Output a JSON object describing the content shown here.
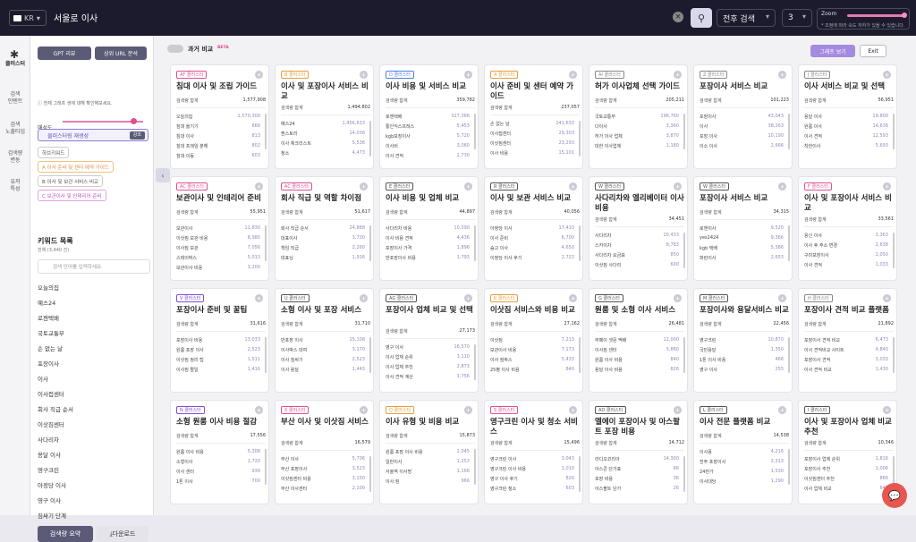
{
  "topbar": {
    "country": "KR",
    "query": "서울로 이사",
    "clear": "×",
    "mode": "전후 검색",
    "depth": "3",
    "zoom_label": "Zoom",
    "zoom_hint": "* 조정에 따라 속도 저하가 있을 수 있습니다."
  },
  "rail": [
    {
      "label": "클러스터"
    },
    {
      "label": "검색\n인텐트"
    },
    {
      "label": "검색\n노출타입"
    },
    {
      "label": "검색량\n변동"
    },
    {
      "label": "유저\n특성"
    }
  ],
  "panel": {
    "gpt": "GPT 리뷰",
    "url": "상위 URL 분석",
    "note": "전체 그래프 생에 대해 확인해보세요.",
    "slider_label": "매성도",
    "cluster_btn": "클러스터링 재생성",
    "cluster_toggle": "강조",
    "tags": [
      {
        "t": "하브키워드",
        "c": "#555",
        "b": "#ccc",
        "bg": "#fff"
      },
      {
        "t": "A 이사 준비 및 센터 예약 가이드",
        "c": "#e09040",
        "b": "#f0c080",
        "bg": "#fff"
      },
      {
        "t": "B 이사 및 보관 서비스 비교",
        "c": "#555",
        "b": "#ccc",
        "bg": "#fff"
      },
      {
        "t": "C 보관이사 및 인테리어 준비",
        "c": "#c050c0",
        "b": "#e0a0e0",
        "bg": "#fff"
      }
    ],
    "kw_title": "키워드 목록",
    "kw_sub": "전체 (3,440 건)",
    "kw_placeholder": "검색 단어를 입력하세요.",
    "keywords": [
      "오늘의집",
      "예스24",
      "로젠택배",
      "국토교통부",
      "손 없는 날",
      "포장이사",
      "이사",
      "이사접센터",
      "회사 직급 순서",
      "이삿짐센터",
      "사다리차",
      "용달 이사",
      "영구크린",
      "아정당 이사",
      "영구 이사",
      "짐싸기 단계"
    ],
    "summary": "검색량 요약",
    "download": "다운로드"
  },
  "main": {
    "compare": "과거 비교",
    "beta": "BETA",
    "graph": "그래프 보기",
    "exit": "Exit"
  },
  "cards": [
    {
      "badge": "AF 클러스터",
      "bc": "#e05090",
      "title": "침대 이사 및 조립 가이드",
      "vol": "1,577,908",
      "rows": [
        [
          "오늘의집",
          "1,570,300"
        ],
        [
          "침대 옮기기",
          "866"
        ],
        [
          "침대 이사",
          "813"
        ],
        [
          "침대 프레임 분해",
          "802"
        ],
        [
          "침대 이동",
          "603"
        ]
      ]
    },
    {
      "badge": "B 클러스터",
      "bc": "#e0a040",
      "title": "이사 및 포장이사 서비스 비교",
      "vol": "1,494,802",
      "rows": [
        [
          "예스24",
          "1,456,633"
        ],
        [
          "퀀스토리",
          "14,036"
        ],
        [
          "이사 체크리스트",
          "5,536"
        ],
        [
          "청소",
          "4,473"
        ]
      ]
    },
    {
      "badge": "D 클러스터",
      "bc": "#5080e0",
      "title": "이사 비용 및 서비스 비교",
      "vol": "359,782",
      "rows": [
        [
          "로젠택배",
          "327,366"
        ],
        [
          "통인익스프레스",
          "5,453"
        ],
        [
          "kgb포장이사",
          "5,720"
        ],
        [
          "이사비",
          "3,060"
        ],
        [
          "이사 견적",
          "2,730"
        ]
      ]
    },
    {
      "badge": "A 클러스터",
      "bc": "#e0a040",
      "title": "이사 준비 및 센터 예약 가이드",
      "vol": "237,057",
      "rows": [
        [
          "손 없는 날",
          "141,633"
        ],
        [
          "이사접센터",
          "29,303"
        ],
        [
          "이삿짐센터",
          "23,293"
        ],
        [
          "이사 비용",
          "15,101"
        ]
      ]
    },
    {
      "badge": "AI 클러스터",
      "bc": "#888",
      "title": "허가 이사업체 선택 가이드",
      "vol": "205,211",
      "rows": [
        [
          "국토교통부",
          "196,760"
        ],
        [
          "다이사",
          "3,360"
        ],
        [
          "허가 이사 업체",
          "3,870"
        ],
        [
          "대한 이사업체",
          "1,180"
        ]
      ]
    },
    {
      "badge": "Z 클러스터",
      "bc": "#888",
      "title": "포장이사 서비스 비교",
      "vol": "101,223",
      "rows": [
        [
          "포장이사",
          "43,043"
        ],
        [
          "이사",
          "38,263"
        ],
        [
          "포장 이사",
          "10,190"
        ],
        [
          "이소 이사",
          "2,666"
        ]
      ]
    },
    {
      "badge": "J 클러스터",
      "bc": "#888",
      "title": "이사 서비스 비교 및 선택",
      "vol": "56,951",
      "rows": [
        [
          "용달 이사",
          "19,800"
        ],
        [
          "원룸 이사",
          "14,636"
        ],
        [
          "이사 견적",
          "12,593"
        ],
        [
          "착한이사",
          "5,693"
        ]
      ]
    },
    {
      "badge": "AC 클러스터",
      "bc": "#e05090",
      "title": "보관이사 및 인테리어 준비",
      "vol": "55,951",
      "rows": [
        [
          "보관이사",
          "11,830"
        ],
        [
          "이삿짐 보관 비용",
          "8,980"
        ],
        [
          "이사짐 보관",
          "7,056"
        ],
        [
          "스테이박스",
          "5,013"
        ],
        [
          "보관이사 비용",
          "3,200"
        ]
      ]
    },
    {
      "badge": "AC 클러스터",
      "bc": "#e05090",
      "title": "회사 직급 및 역할 차이점",
      "vol": "51,617",
      "rows": [
        [
          "회사 직급 순서",
          "24,888"
        ],
        [
          "대표이사",
          "3,730"
        ],
        [
          "책임 직급",
          "2,260"
        ],
        [
          "대표님",
          "1,916"
        ]
      ]
    },
    {
      "badge": "E 클러스터",
      "bc": "#555",
      "title": "이사 비용 및 업체 비교",
      "vol": "44,897",
      "rows": [
        [
          "사다리차 비용",
          "10,590"
        ],
        [
          "이사 비용 견적",
          "4,436"
        ],
        [
          "포장이사 가격",
          "1,896"
        ],
        [
          "반포장이사 비용",
          "1,793"
        ]
      ]
    },
    {
      "badge": "R 클러스터",
      "bc": "#555",
      "title": "이사 및 보관 서비스 비교",
      "vol": "40,056",
      "rows": [
        [
          "아정당 이사",
          "17,410"
        ],
        [
          "이사 준비",
          "6,700"
        ],
        [
          "숨고 이사",
          "4,650"
        ],
        [
          "이정당 이사 후기",
          "2,723"
        ]
      ]
    },
    {
      "badge": "W 클러스터",
      "bc": "#555",
      "title": "사다리차와 엘리베이터 이사 비용",
      "vol": "34,451",
      "rows": [
        [
          "사다리차",
          "20,433"
        ],
        [
          "스카이차",
          "8,783"
        ],
        [
          "사다리차 요금표",
          "850"
        ],
        [
          "이삿짐 사다리",
          "600"
        ]
      ]
    },
    {
      "badge": "W 클러스터",
      "bc": "#555",
      "title": "포장이사 서비스 비교",
      "vol": "34,315",
      "rows": [
        [
          "로젠이사",
          "9,520"
        ],
        [
          "yes2424",
          "9,366"
        ],
        [
          "kgb 택배",
          "5,386"
        ],
        [
          "파란이사",
          "2,653"
        ]
      ]
    },
    {
      "badge": "F 클러스터",
      "bc": "#e05090",
      "title": "이사 및 포장이사 서비스 비교",
      "vol": "33,561",
      "rows": [
        [
          "용신 이사",
          "3,363"
        ],
        [
          "이사 후 주소 변경",
          "2,638"
        ],
        [
          "구미포장이사",
          "2,050"
        ],
        [
          "이사 견적",
          "1,033"
        ]
      ]
    },
    {
      "badge": "V 클러스터",
      "bc": "#8050d0",
      "title": "포장이사 준비 및 꿀팁",
      "vol": "31,616",
      "rows": [
        [
          "포장이사 비용",
          "13,033"
        ],
        [
          "원룸 포장 이사",
          "2,523"
        ],
        [
          "이삿짐 정리 팁",
          "1,511"
        ],
        [
          "이사짐 짤일",
          "1,416"
        ]
      ]
    },
    {
      "badge": "U 클러스터",
      "bc": "#555",
      "title": "소형 이사 및 포장 서비스",
      "vol": "31,710",
      "rows": [
        [
          "반포장 이사",
          "15,108"
        ],
        [
          "이사박스 대여",
          "3,170"
        ],
        [
          "이사 침싸기",
          "2,523"
        ],
        [
          "이사 용달",
          "1,443"
        ]
      ]
    },
    {
      "badge": "AG 클러스터",
      "bc": "#555",
      "title": "포장이사 업체 비교 및 선택",
      "vol": "27,173",
      "rows": [
        [
          "영구 이사",
          "16,570"
        ],
        [
          "이사 업체 순위",
          "3,110"
        ],
        [
          "이사 업체 추천",
          "2,873"
        ],
        [
          "이사 견적 계산",
          "1,756"
        ]
      ]
    },
    {
      "badge": "K 클러스터",
      "bc": "#e0a040",
      "title": "이삿짐 서비스와 비용 비교",
      "vol": "27,162",
      "rows": [
        [
          "이삿짐",
          "7,213"
        ],
        [
          "보관이사 비용",
          "7,173"
        ],
        [
          "이사 짐박스",
          "5,433"
        ],
        [
          "25평 이사 비용",
          "840"
        ]
      ]
    },
    {
      "badge": "G 클러스터",
      "bc": "#555",
      "title": "원룸 및 소형 이사 서비스",
      "vol": "26,481",
      "rows": [
        [
          "부페이 셋문 맥배",
          "12,000"
        ],
        [
          "이사짐 센터",
          "3,860"
        ],
        [
          "원룸 이사 비용",
          "840"
        ],
        [
          "용달 이사 비용",
          "826"
        ]
      ]
    },
    {
      "badge": "M 클러스터",
      "bc": "#555",
      "title": "포장이사와 용달서비스 비교",
      "vol": "22,456",
      "rows": [
        [
          "영구크린",
          "10,870"
        ],
        [
          "국민용달",
          "1,350"
        ],
        [
          "1톤 이사 비용",
          "466"
        ],
        [
          "영구 이사",
          "255"
        ]
      ]
    },
    {
      "badge": "H 클러스터",
      "bc": "#888",
      "title": "포장이사 견적 비교 플랫폼",
      "vol": "21,892",
      "rows": [
        [
          "포장이사 견적 비교",
          "6,473"
        ],
        [
          "이사 견적비교 사이트",
          "4,840"
        ],
        [
          "포장이사 견적",
          "3,033"
        ],
        [
          "이사 견적 비교",
          "1,430"
        ]
      ]
    },
    {
      "badge": "N 클러스터",
      "bc": "#8050d0",
      "title": "소형 원룸 이사 비용 절감",
      "vol": "17,556",
      "rows": [
        [
          "원룸 이사 비용",
          "5,308"
        ],
        [
          "소형이사",
          "1,720"
        ],
        [
          "이사 센터",
          "936"
        ],
        [
          "1톤 이사",
          "700"
        ]
      ]
    },
    {
      "badge": "X 클러스터",
      "bc": "#e05090",
      "title": "부산 이사 및 이삿짐 서비스",
      "vol": "16,579",
      "rows": [
        [
          "부산 이사",
          "5,706"
        ],
        [
          "부산 포장이사",
          "3,523"
        ],
        [
          "이삿짐센터 비용",
          "3,150"
        ],
        [
          "부산 이사센터",
          "2,100"
        ]
      ]
    },
    {
      "badge": "Q 클러스터",
      "bc": "#e0a040",
      "title": "이사 유형 및 비용 비교",
      "vol": "15,873",
      "rows": [
        [
          "원룸 포장 이사 비용",
          "2,045"
        ],
        [
          "일반이사",
          "1,253"
        ],
        [
          "서울역 이사방",
          "1,166"
        ],
        [
          "이사 짐",
          "966"
        ]
      ]
    },
    {
      "badge": "S 클러스터",
      "bc": "#e05090",
      "title": "영구크린 이사 및 청소 서비스",
      "vol": "15,496",
      "rows": [
        [
          "영구크린 이사",
          "3,043"
        ],
        [
          "영구크린 이사 비용",
          "1,010"
        ],
        [
          "영구 이사 후기",
          "826"
        ],
        [
          "영구크린 청소",
          "603"
        ]
      ]
    },
    {
      "badge": "AD 클러스터",
      "bc": "#555",
      "title": "엘에이 포장이사 및 아스팔트 포장 비용",
      "vol": "14,712",
      "rows": [
        [
          "라디오코리아",
          "14,300"
        ],
        [
          "아스콘 단가표",
          "66"
        ],
        [
          "포장 비용",
          "36"
        ],
        [
          "아스팔트 단가",
          "26"
        ]
      ]
    },
    {
      "badge": "L 클러스터",
      "bc": "#555",
      "title": "이사 전문 플랫폼 비교",
      "vol": "14,538",
      "rows": [
        [
          "이사몽",
          "4,216"
        ],
        [
          "전주 포장이사",
          "2,313"
        ],
        [
          "24번가",
          "1,530"
        ],
        [
          "이사대당",
          "1,290"
        ]
      ]
    },
    {
      "badge": "I 클러스터",
      "bc": "#555",
      "title": "이사 및 포장이사 업체 비교 추천",
      "vol": "10,346",
      "rows": [
        [
          "포장이사 업체 순위",
          "1,816"
        ],
        [
          "포장이사 추천",
          "1,006"
        ],
        [
          "이삿짐센터 추천",
          "866"
        ],
        [
          "이사 업체 비교",
          "643"
        ]
      ]
    }
  ],
  "card_common": {
    "vol_label": "검색량 합계"
  }
}
